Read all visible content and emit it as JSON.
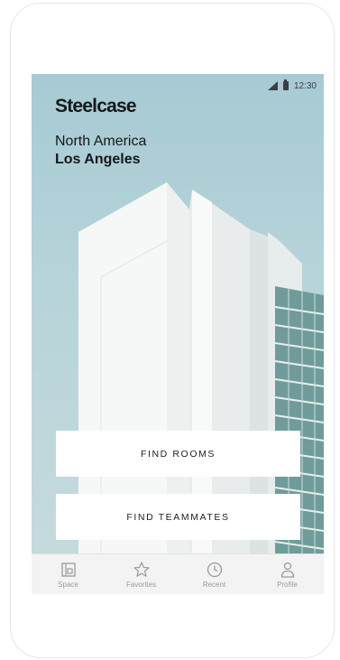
{
  "status_bar": {
    "time": "12:30"
  },
  "brand": {
    "name": "Steelcase"
  },
  "location": {
    "region": "North America",
    "city": "Los Angeles"
  },
  "actions": {
    "find_rooms": "FIND ROOMS",
    "find_teammates": "FIND TEAMMATES"
  },
  "tabbar": {
    "tabs": [
      {
        "label": "Space",
        "icon": "space-icon"
      },
      {
        "label": "Favorites",
        "icon": "star-icon"
      },
      {
        "label": "Recent",
        "icon": "clock-icon"
      },
      {
        "label": "Profile",
        "icon": "person-icon"
      }
    ]
  },
  "colors": {
    "sky": "#a9cbd3",
    "building": "#f4f4f4",
    "glass": "#6f9c9a",
    "tab_icon": "#9a9a9a"
  }
}
